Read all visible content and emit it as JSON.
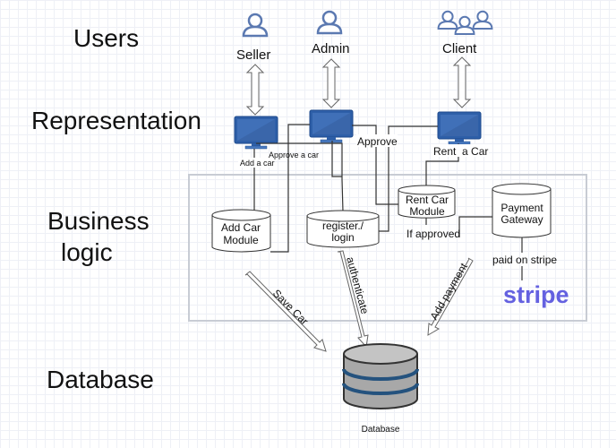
{
  "layers": {
    "users": "Users",
    "representation": "Representation",
    "business1": "Business",
    "business2": "logic",
    "database": "Database"
  },
  "actors": {
    "seller": "Seller",
    "admin": "Admin",
    "client": "Client"
  },
  "modules": {
    "add_car_1": "Add Car",
    "add_car_2": "Module",
    "register_1": "register./",
    "register_2": "login",
    "rent_car_1": "Rent Car",
    "rent_car_2": "Module",
    "payment_1": "Payment",
    "payment_2": "Gateway",
    "database": "Database"
  },
  "edges": {
    "add_a_car": "Add a car",
    "approve_a_car": "Approve a car",
    "approve": "Approve",
    "rent_a_car": "Rent  a Car",
    "if_approved": "If approved",
    "paid_on_stripe": "paid on stripe",
    "save_car": "Save Car",
    "authenticate": "authenticate",
    "add_payment": "Add payment"
  },
  "logo": "stripe",
  "colors": {
    "monitor": "#2e5fa8",
    "icon": "#5b79b1",
    "stripe": "#6461e0",
    "db_band": "#24527e"
  }
}
